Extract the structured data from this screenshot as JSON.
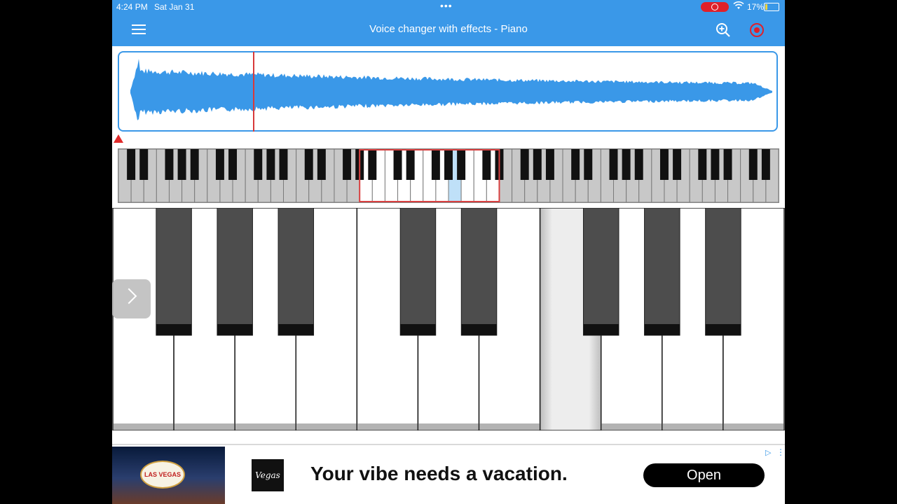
{
  "status_bar": {
    "time": "4:24 PM",
    "date": "Sat Jan 31",
    "dots": "•••",
    "battery_percent": "17%",
    "battery_level": 0.17
  },
  "toolbar": {
    "title": "Voice changer with effects - Piano",
    "menu_icon": "hamburger-menu-icon",
    "zoom_icon": "zoom-in-icon",
    "record_icon": "record-icon"
  },
  "colors": {
    "accent": "#3a98e8",
    "waveform": "#3a98e8",
    "playhead": "#d83a3a",
    "selection": "#d84040",
    "pressed_mini_key": "#bfe0f8",
    "black_key": "#4d4d4d",
    "black_key_tip": "#111111"
  },
  "waveform": {
    "playhead_position": 0.035
  },
  "mini_keyboard": {
    "white_key_count": 52,
    "selection_start_key": 19,
    "selection_key_count": 11,
    "pressed_white_key": 26
  },
  "main_keyboard": {
    "white_key_count": 11,
    "black_key_after_white": [
      0,
      1,
      2,
      4,
      5,
      7,
      8,
      9
    ],
    "pressed_white_key": 7
  },
  "ad": {
    "sign_text": "LAS VEGAS",
    "logo_text": "Vegas",
    "headline": "Your vibe needs a vacation.",
    "button_label": "Open",
    "adchoices_icon": "adchoices-icon",
    "more_icon": "more-vertical-icon"
  },
  "overlay": {
    "next_icon": "chevron-right-icon"
  }
}
